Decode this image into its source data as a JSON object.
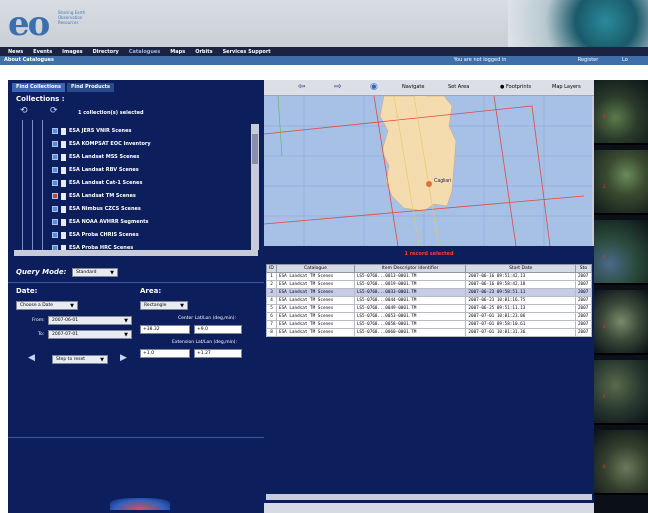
{
  "header": {
    "logo_text": "eo",
    "logo_subtext": "Sharing Earth Observation Resources"
  },
  "nav": {
    "items": [
      "News",
      "Events",
      "Images",
      "Directory",
      "Catalogues",
      "Maps",
      "Orbits",
      "Services Support"
    ],
    "active": "Catalogues"
  },
  "subbar": {
    "title": "About Catalogues",
    "right_1": "You are not logged in",
    "right_2": "Register",
    "right_3": "Lo"
  },
  "left_panel": {
    "tabs": [
      "Find Collections",
      "Find Products"
    ],
    "collections_label": "Collections :",
    "selected_text": "1 collection(s) selected",
    "collections": [
      {
        "label": "ESA JERS VNIR Scenes",
        "checked": false
      },
      {
        "label": "ESA KOMPSAT EOC Inventory",
        "checked": false
      },
      {
        "label": "ESA Landsat MSS Scenes",
        "checked": false
      },
      {
        "label": "ESA Landsat RBV Scenes",
        "checked": false
      },
      {
        "label": "ESA Landsat Cat-1 Scenes",
        "checked": false
      },
      {
        "label": "ESA Landsat TM Scenes",
        "checked": true
      },
      {
        "label": "ESA Nimbus CZCS Scenes",
        "checked": false
      },
      {
        "label": "ESA NOAA AVHRR Segments",
        "checked": false
      },
      {
        "label": "ESA Proba CHRIS Scenes",
        "checked": false
      },
      {
        "label": "ESA Proba HRC Scenes",
        "checked": false
      }
    ],
    "query_mode_label": "Query Mode:",
    "query_mode_value": "Standard",
    "date_label": "Date:",
    "area_label": "Area:",
    "date_type": "Choose a Date",
    "area_type": "Rectangle",
    "from_label": "From:",
    "from_value": "2007-06-01",
    "to_label": "To:",
    "to_value": "2007-07-01",
    "center_label": "Center Lat/Lon (deg,min):",
    "center_lat": "+38.32",
    "center_lon": "+9.0",
    "extension_label": "Extension Lat/Lon (deg,min):",
    "ext_lat": "+1.0",
    "ext_lon": "+1.27",
    "step_value": "Step to reset"
  },
  "map_panel": {
    "toolbar": {
      "navigate_label": "Navigate",
      "set_area_label": "Set Area",
      "footprints_label": "Footprints",
      "map_layers_label": "Map Layers"
    },
    "city_label": "Cagliari",
    "results_selected": "1 record selected",
    "columns": [
      "ID",
      "Catalogue",
      "Item Descriptor Identifier",
      "Start Date",
      "Sto"
    ],
    "rows": [
      {
        "id": "1",
        "catalogue": "ESA Landsat TM Scenes",
        "item": "LS5-0768...0013-0001.TM",
        "start": "2007-06-16 09:51:42.13",
        "stop": "2007",
        "selected": false
      },
      {
        "id": "2",
        "catalogue": "ESA Landsat TM Scenes",
        "item": "LS5-0768...0019-0001.TM",
        "start": "2007-06-16 09:58:42.18",
        "stop": "2007",
        "selected": false
      },
      {
        "id": "3",
        "catalogue": "ESA Landsat TM Scenes",
        "item": "LS5-0768...0033-0001.TM",
        "start": "2007-06-23 09:58:51.11",
        "stop": "2007",
        "selected": true
      },
      {
        "id": "4",
        "catalogue": "ESA Landsat TM Scenes",
        "item": "LS5-0768...0044-0001.TM",
        "start": "2007-06-23 10:01:16.75",
        "stop": "2007",
        "selected": false
      },
      {
        "id": "5",
        "catalogue": "ESA Landsat TM Scenes",
        "item": "LS5-0768...0049-0001.TM",
        "start": "2007-06-25 09:51:11.13",
        "stop": "2007",
        "selected": false
      },
      {
        "id": "6",
        "catalogue": "ESA Landsat TM Scenes",
        "item": "LS5-0768...0053-0001.TM",
        "start": "2007-07-01 10:01:23.06",
        "stop": "2007",
        "selected": false
      },
      {
        "id": "7",
        "catalogue": "ESA Landsat TM Scenes",
        "item": "LS5-0768...0058-0001.TM",
        "start": "2007-07-01 09:58:10.61",
        "stop": "2007",
        "selected": false
      },
      {
        "id": "8",
        "catalogue": "ESA Landsat TM Scenes",
        "item": "LS5-0768...0060-0001.TM",
        "start": "2007-07-01 10:01:31.36",
        "stop": "2007",
        "selected": false
      }
    ]
  },
  "thumbs": {
    "numbers": [
      "1",
      "2",
      "3",
      "4",
      "5",
      "6"
    ]
  },
  "colors": {
    "panel_navy": "#0c1e5c",
    "nav_dark": "#1c2340",
    "subbar_blue": "#3f6ea8",
    "map_sea": "#a6c0e6",
    "land": "#f4dcae",
    "footprint_red": "#e04848",
    "highlight_red": "#ff3a3a"
  }
}
